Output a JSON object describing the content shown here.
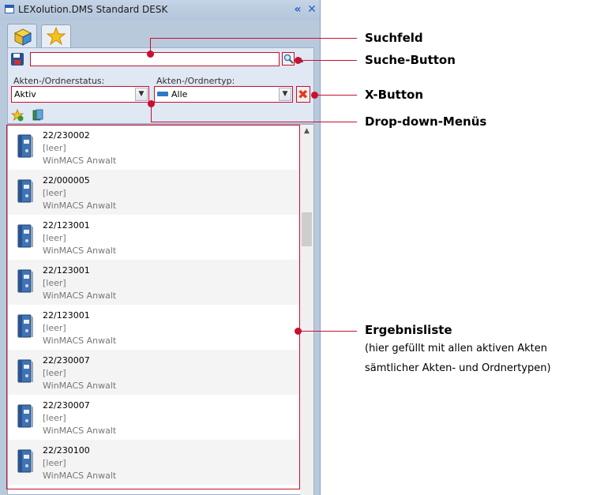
{
  "window": {
    "title": "LEXolution.DMS Standard DESK",
    "buttons": [
      "double-chevron-left-icon",
      "close-icon"
    ]
  },
  "tabs": [
    {
      "name": "files-tab",
      "icon": "cube-folder-icon"
    },
    {
      "name": "favorites-tab",
      "icon": "star-icon"
    }
  ],
  "search": {
    "value": "",
    "placeholder": ""
  },
  "filters": {
    "status_label": "Akten-/Ordnerstatus:",
    "status_value": "Aktiv",
    "type_label": "Akten-/Ordnertyp:",
    "type_value": "Alle",
    "type_color": "#2f78c8"
  },
  "results": [
    {
      "number": "22/230002",
      "line2": "[leer]",
      "line3": "WinMACS Anwalt"
    },
    {
      "number": "22/000005",
      "line2": "[leer]",
      "line3": "WinMACS Anwalt"
    },
    {
      "number": "22/123001",
      "line2": "[leer]",
      "line3": "WinMACS Anwalt"
    },
    {
      "number": "22/123001",
      "line2": "[leer]",
      "line3": "WinMACS Anwalt"
    },
    {
      "number": "22/123001",
      "line2": "[leer]",
      "line3": "WinMACS Anwalt"
    },
    {
      "number": "22/230007",
      "line2": "[leer]",
      "line3": "WinMACS Anwalt"
    },
    {
      "number": "22/230007",
      "line2": "[leer]",
      "line3": "WinMACS Anwalt"
    },
    {
      "number": "22/230100",
      "line2": "[leer]",
      "line3": "WinMACS Anwalt"
    }
  ],
  "annotations": {
    "suchfeld": "Suchfeld",
    "suche_button": "Suche-Button",
    "x_button": "X-Button",
    "dropdown": "Drop-down-Menüs",
    "ergebnisliste": "Ergebnisliste",
    "note_line1": "(hier gefüllt mit allen aktiven Akten",
    "note_line2": "sämtlicher Akten- und Ordnertypen)"
  },
  "colors": {
    "annotation": "#c8102e",
    "panel": "#dfe8f3",
    "window": "#b9c9dc"
  }
}
